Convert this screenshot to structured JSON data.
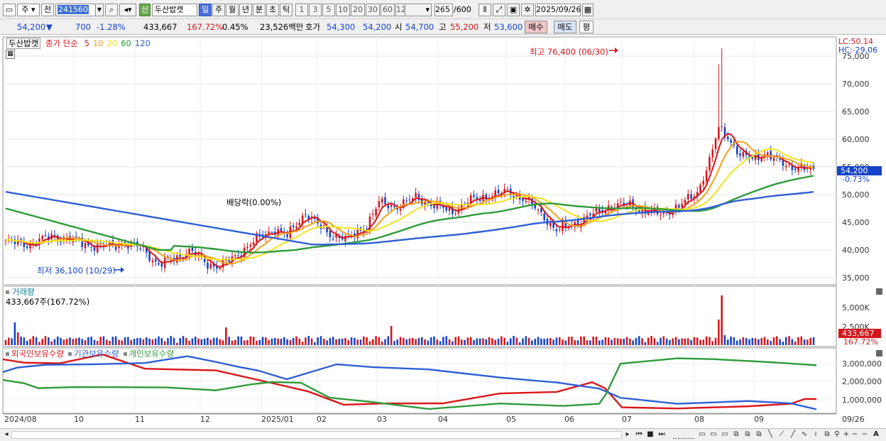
{
  "toolbar": {
    "market": "주",
    "prev_label": "전",
    "code": "241560",
    "sin_label": "신",
    "stock_name": "두산밥캣",
    "periods": [
      "일",
      "주",
      "월",
      "년",
      "분",
      "초",
      "틱"
    ],
    "selected_period": "일",
    "intervals": [
      "1",
      "3",
      "5",
      "10",
      "20",
      "30",
      "60",
      "120"
    ],
    "count_value": "265",
    "count_total": "/600",
    "date": "2025/09/26"
  },
  "quote": {
    "price": "54,200",
    "arrow": "▼",
    "change": "700",
    "change_pct": "-1.28%",
    "volume": "433,667",
    "volume_ratio": "167.72%",
    "turnover_pct": "0.45%",
    "amount": "23,526백만",
    "hoga_label": "호가",
    "ask": "54,300",
    "bid": "54,200",
    "open_label": "시",
    "open": "54,700",
    "high_label": "고",
    "high": "55,200",
    "low_label": "저",
    "low": "53,600",
    "buy_button": "매수",
    "sell_button": "매도",
    "eval_button": "평"
  },
  "price_panel": {
    "name_tag": "두산밥캣",
    "legend_prefix": "종가 단순",
    "ma_periods": [
      "5",
      "10",
      "20",
      "60",
      "120"
    ],
    "ma_colors": [
      "#d9161a",
      "#f5a11a",
      "#f2e31e",
      "#2e9b3b",
      "#2f5fd6"
    ],
    "lc_label": "LC:50.14",
    "hc_label": "HC:-29.06",
    "y_ticks": [
      "75,000",
      "70,000",
      "65,000",
      "60,000",
      "55,000",
      "50,000",
      "45,000",
      "40,000",
      "35,000"
    ],
    "current_price_tag": "54,200",
    "current_pct_tag": "-0.73%",
    "high_annotation": "최고 76,400 (06/30)",
    "low_annotation": "최저 36,100 (10/29)",
    "dividend_annotation": "배당락(0.00%)"
  },
  "volume_panel": {
    "title": "거래량",
    "subtitle": "433,667주(167.72%)",
    "y_ticks": [
      "5,000K",
      "2,500K"
    ],
    "tag_value": "433,667",
    "tag_pct": "167.72%"
  },
  "holdings_panel": {
    "legends": [
      "외국인보유수량",
      "기관보유수량",
      "개인보유수량"
    ],
    "legend_colors": [
      "#d9161a",
      "#2f5fd6",
      "#2e9b3b"
    ],
    "y_ticks": [
      "3,000,000",
      "2,000,000",
      "1,000,000"
    ]
  },
  "x_axis": {
    "labels": [
      "2024/08",
      "10",
      "11",
      "12",
      "2025/01",
      "02",
      "03",
      "04",
      "05",
      "06",
      "07",
      "08",
      "09"
    ],
    "right_label": "09/26"
  },
  "colors": {
    "up": "#d5171c",
    "down": "#1543c9",
    "toolbar_bg": "#f0f0f0"
  }
}
